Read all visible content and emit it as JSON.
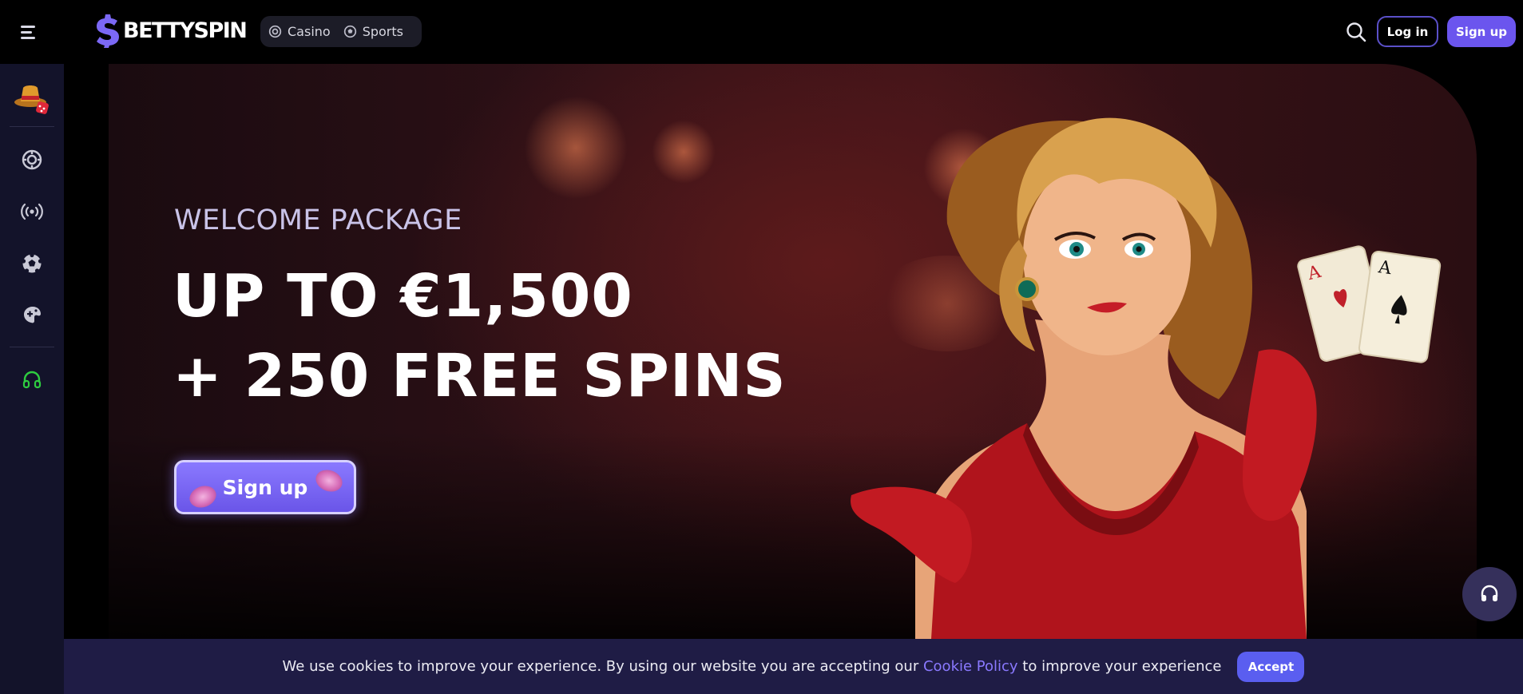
{
  "header": {
    "menu_icon": "hamburger-menu-icon",
    "logo_text": "BETTYSPIN",
    "nav": [
      {
        "label": "Casino",
        "icon": "casino-chip-icon"
      },
      {
        "label": "Sports",
        "icon": "soccer-ball-icon"
      }
    ],
    "search_icon": "search-icon",
    "login_label": "Log in",
    "signup_label": "Sign up"
  },
  "sidebar": {
    "avatar": "hat-dice-avatar",
    "items": [
      {
        "icon": "casino-chip-icon"
      },
      {
        "icon": "live-broadcast-icon"
      },
      {
        "icon": "soccer-ball-icon"
      },
      {
        "icon": "gamepad-icon"
      },
      {
        "icon": "headset-support-icon"
      }
    ]
  },
  "hero": {
    "subtitle": "WELCOME PACKAGE",
    "title_line1": "UP TO €1,500",
    "title_line2": "+ 250 FREE SPINS",
    "cta_label": "Sign up"
  },
  "support_icon": "headset-support-icon",
  "cookie": {
    "text_before": "We use cookies to improve your experience. By using our website you are accepting our ",
    "link": "Cookie Policy",
    "text_after": " to improve your experience",
    "accept_label": "Accept"
  },
  "colors": {
    "accent": "#6b55ee",
    "link": "#8a79ff",
    "sidebar_bg": "#13132a",
    "cookie_bg": "#1f1c45",
    "support_green": "#2ecc40"
  }
}
